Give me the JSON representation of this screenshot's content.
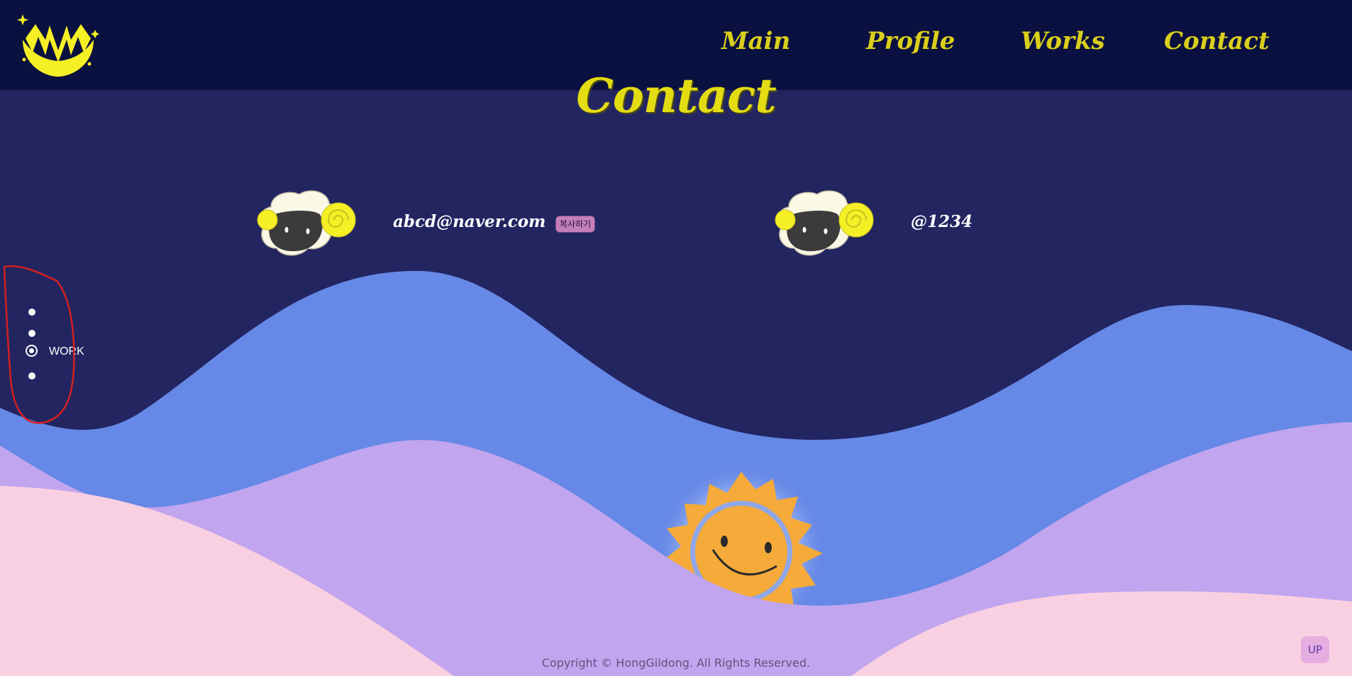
{
  "header": {
    "logo_alt": "HM",
    "nav": [
      {
        "label": "Main"
      },
      {
        "label": "Profile"
      },
      {
        "label": "Works"
      },
      {
        "label": "Contact"
      }
    ]
  },
  "main": {
    "title": "Contact",
    "contacts": [
      {
        "icon": "sheep-icon",
        "text": "abcd@naver.com",
        "action": "복사하기"
      },
      {
        "icon": "sheep-icon",
        "text": "@1234"
      }
    ]
  },
  "side_nav": {
    "active_label": "WORK",
    "active_index": 2,
    "count": 4
  },
  "footer": {
    "copyright": "Copyright © HongGildong. All Rights Reserved.",
    "up_label": "UP"
  },
  "colors": {
    "header_bg": "#0a103f",
    "page_bg": "#232561",
    "accent_yellow": "#e4dc12",
    "wave_blue": "#6688e6",
    "wave_purple": "#c1a5ee",
    "wave_pink": "#f9d0e2",
    "sun": "#f6aa3a",
    "annotation_red": "#d42020"
  }
}
